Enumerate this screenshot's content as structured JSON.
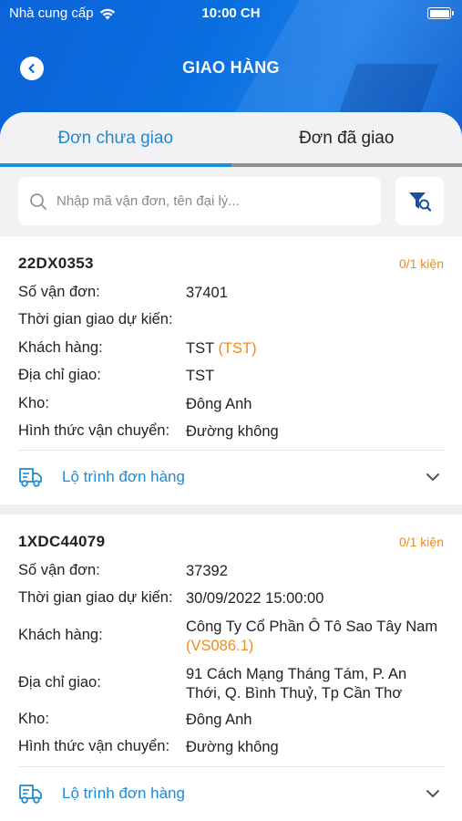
{
  "status_bar": {
    "carrier": "Nhà cung cấp",
    "time": "10:00 CH"
  },
  "header": {
    "title": "GIAO HÀNG"
  },
  "tabs": [
    {
      "label": "Đơn chưa giao",
      "active": true
    },
    {
      "label": "Đơn đã giao",
      "active": false
    }
  ],
  "search": {
    "placeholder": "Nhập mã vận đơn, tên đại lý...",
    "value": ""
  },
  "labels": {
    "waybill": "Số vận đơn:",
    "eta": "Thời gian giao dự kiến:",
    "customer": "Khách hàng:",
    "address": "Địa chỉ giao:",
    "warehouse": "Kho:",
    "shipping": "Hình thức vận chuyển:",
    "route": "Lộ trình đơn hàng"
  },
  "orders": [
    {
      "code": "22DX0353",
      "count": "0/1 kiện",
      "waybill": "37401",
      "eta": "",
      "customer_name": "TST",
      "customer_code": "(TST)",
      "address": "TST",
      "warehouse": "Đông Anh",
      "shipping": "Đường không"
    },
    {
      "code": "1XDC44079",
      "count": "0/1 kiện",
      "waybill": "37392",
      "eta": "30/09/2022 15:00:00",
      "customer_name": "Công Ty Cổ Phần Ô Tô Sao Tây Nam",
      "customer_code": "(VS086.1)",
      "address": "91 Cách Mạng Tháng Tám, P. An Thới, Q. Bình Thuỷ, Tp Cần Thơ",
      "warehouse": "Đông Anh",
      "shipping": "Đường không"
    }
  ],
  "colors": {
    "accent": "#1f8ad6",
    "count": "#f08a1c",
    "header": "#0b63d8"
  }
}
